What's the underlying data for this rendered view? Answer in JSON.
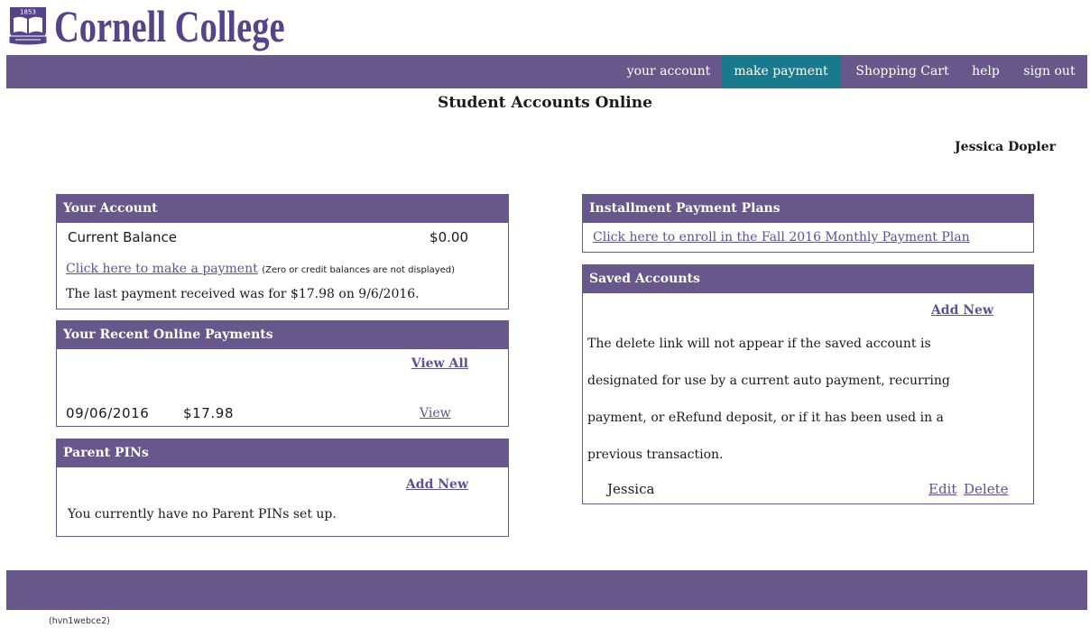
{
  "brand": {
    "name": "Cornell College",
    "seal_year": "1853",
    "logo_icon": "college-seal-icon"
  },
  "nav": {
    "items": [
      {
        "label": "your account",
        "active": false
      },
      {
        "label": "make payment",
        "active": true
      },
      {
        "label": "Shopping Cart",
        "active": false
      },
      {
        "label": "help",
        "active": false
      },
      {
        "label": "sign out",
        "active": false
      }
    ]
  },
  "page_title": "Student Accounts Online",
  "user_name": "Jessica Dopler",
  "your_account": {
    "heading": "Your Account",
    "balance_label": "Current Balance",
    "balance_value": "$0.00",
    "pay_link": "Click here to make a payment",
    "pay_note": "(Zero or credit balances are not displayed)",
    "last_payment": "The last payment received was for $17.98 on 9/6/2016."
  },
  "recent_payments": {
    "heading": "Your Recent Online Payments",
    "view_all": "View All",
    "rows": [
      {
        "date": "09/06/2016",
        "amount": "$17.98",
        "view": "View"
      }
    ]
  },
  "parent_pins": {
    "heading": "Parent PINs",
    "add_new": "Add New",
    "empty_message": "You currently have no Parent PINs set up."
  },
  "installment_plans": {
    "heading": "Installment Payment Plans",
    "enroll_link": "Click here to enroll in the Fall 2016 Monthly Payment Plan"
  },
  "saved_accounts": {
    "heading": "Saved Accounts",
    "add_new": "Add New",
    "notice_lines": [
      "The delete link will not appear if the saved account is",
      "designated for use by a current auto payment, recurring",
      "payment, or eRefund deposit, or if it has been used in a",
      "previous transaction."
    ],
    "accounts": [
      {
        "name": "Jessica",
        "edit": "Edit",
        "delete": "Delete"
      }
    ]
  },
  "footer": {
    "server_id": "(hvn1webce2)"
  },
  "colors": {
    "brand_purple": "#67578b",
    "brand_text": "#55448a",
    "active_tab": "#197a8d",
    "link": "#5e5290"
  }
}
